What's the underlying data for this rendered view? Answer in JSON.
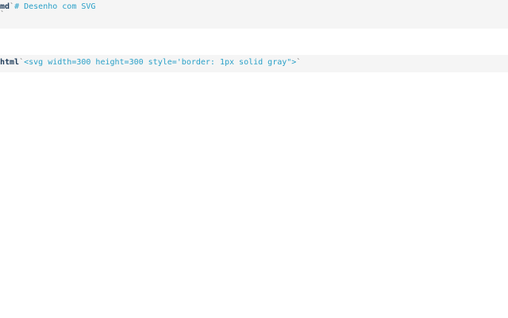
{
  "cells": [
    {
      "lang": "md",
      "open_tick": "`",
      "source": "# Desenho com SVG",
      "close_tick": "`"
    },
    {
      "lang": "html",
      "open_tick": "`",
      "source": "<svg width=300 height=300 style='border: 1px solid gray\">",
      "close_tick": "`"
    }
  ]
}
